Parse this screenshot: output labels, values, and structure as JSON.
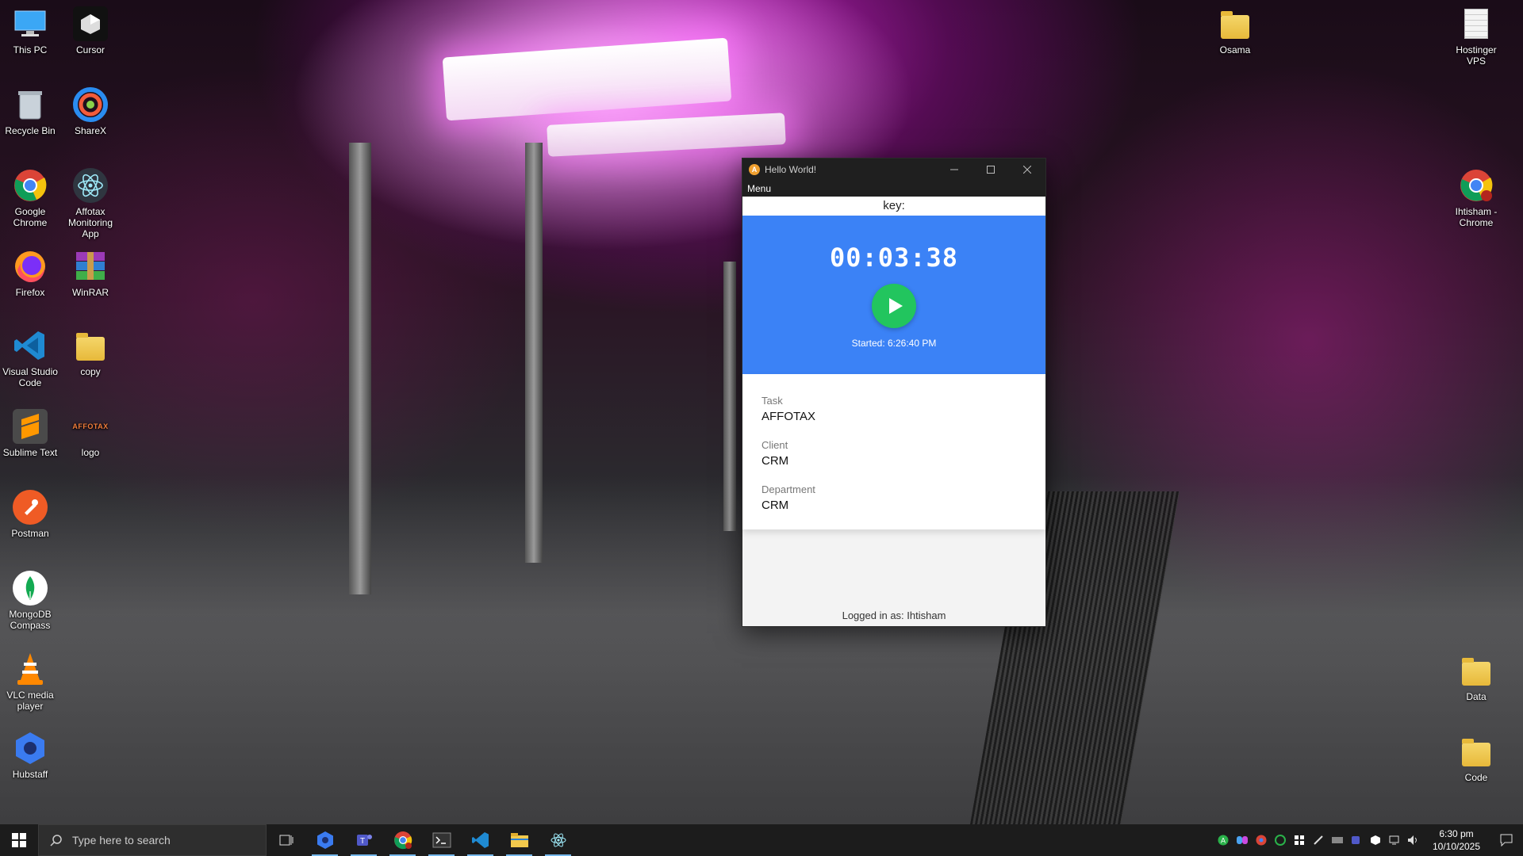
{
  "desktop": {
    "left_icons": [
      {
        "label": "This PC",
        "icon": "computer-icon"
      },
      {
        "label": "Cursor",
        "icon": "cursor-app-icon"
      },
      {
        "label": "Recycle Bin",
        "icon": "recycle-bin-icon"
      },
      {
        "label": "ShareX",
        "icon": "sharex-icon"
      },
      {
        "label": "Google Chrome",
        "icon": "chrome-icon"
      },
      {
        "label": "Affotax Monitoring App",
        "icon": "electron-icon"
      },
      {
        "label": "Firefox",
        "icon": "firefox-icon"
      },
      {
        "label": "WinRAR",
        "icon": "winrar-icon"
      },
      {
        "label": "Visual Studio Code",
        "icon": "vscode-icon"
      },
      {
        "label": "copy",
        "icon": "folder-icon"
      },
      {
        "label": "Sublime Text",
        "icon": "sublime-icon"
      },
      {
        "label": "logo",
        "icon": "affotax-logo-icon",
        "text": "AFFOTAX"
      },
      {
        "label": "Postman",
        "icon": "postman-icon"
      },
      {
        "label": "MongoDB Compass",
        "icon": "mongodb-icon"
      },
      {
        "label": "VLC media player",
        "icon": "vlc-icon"
      },
      {
        "label": "Hubstaff",
        "icon": "hubstaff-icon"
      }
    ],
    "right_icons": [
      {
        "label": "Osama",
        "icon": "folder-icon"
      },
      {
        "label": "Hostinger VPS",
        "icon": "document-icon"
      },
      {
        "label": "Ihtisham - Chrome",
        "icon": "chrome-icon"
      },
      {
        "label": "Data",
        "icon": "folder-icon"
      },
      {
        "label": "Code",
        "icon": "folder-icon"
      }
    ]
  },
  "window": {
    "title": "Hello World!",
    "logo_letter": "A",
    "menu_label": "Menu",
    "key_label": "key:",
    "timer": "00:03:38",
    "started": "Started: 6:26:40 PM",
    "details": [
      {
        "label": "Task",
        "value": "AFFOTAX"
      },
      {
        "label": "Client",
        "value": "CRM"
      },
      {
        "label": "Department",
        "value": "CRM"
      }
    ],
    "footer": "Logged in as: Ihtisham",
    "colors": {
      "timer_bg": "#3b82f6",
      "play": "#22c55e"
    }
  },
  "taskbar": {
    "search_placeholder": "Type here to search",
    "time": "6:30 pm",
    "date": "10/10/2025"
  }
}
